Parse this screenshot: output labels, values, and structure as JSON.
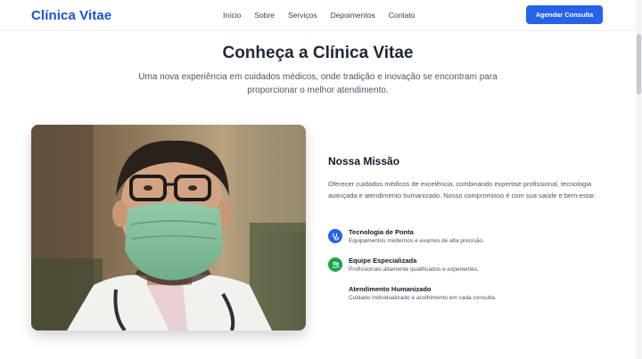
{
  "brand": {
    "name": "Clínica Vitae",
    "accent": "#1d4ed8",
    "button_color": "#2563eb"
  },
  "nav": {
    "items": [
      "Início",
      "Sobre",
      "Serviços",
      "Depoimentos",
      "Contato"
    ],
    "cta_label": "Agendar Consulta"
  },
  "hero": {
    "title": "Conheça a Clínica Vitae",
    "subtitle": "Uma nova experiência em cuidados médicos, onde tradição e inovação se encontram para proporcionar o melhor atendimento."
  },
  "photo": {
    "icon": "doctor-with-mask-photo"
  },
  "mission": {
    "title": "Nossa Missão",
    "text": "Oferecer cuidados médicos de excelência, combinando expertise profissional, tecnologia avançada e atendimento humanizado. Nosso compromisso é com sua saúde e bem-estar.",
    "features": [
      {
        "title": "Tecnologia de Ponta",
        "desc": "Equipamentos modernos e exames de alta precisão.",
        "icon": "stethoscope-icon",
        "color": "#2563eb"
      },
      {
        "title": "Equipe Especializada",
        "desc": "Profissionais altamente qualificados e experientes.",
        "icon": "team-icon",
        "color": "#16a34a"
      },
      {
        "title": "Atendimento Humanizado",
        "desc": "Cuidado individualizado e acolhimento em cada consulta.",
        "icon": "heart-icon",
        "color": "#ffffff"
      }
    ]
  }
}
